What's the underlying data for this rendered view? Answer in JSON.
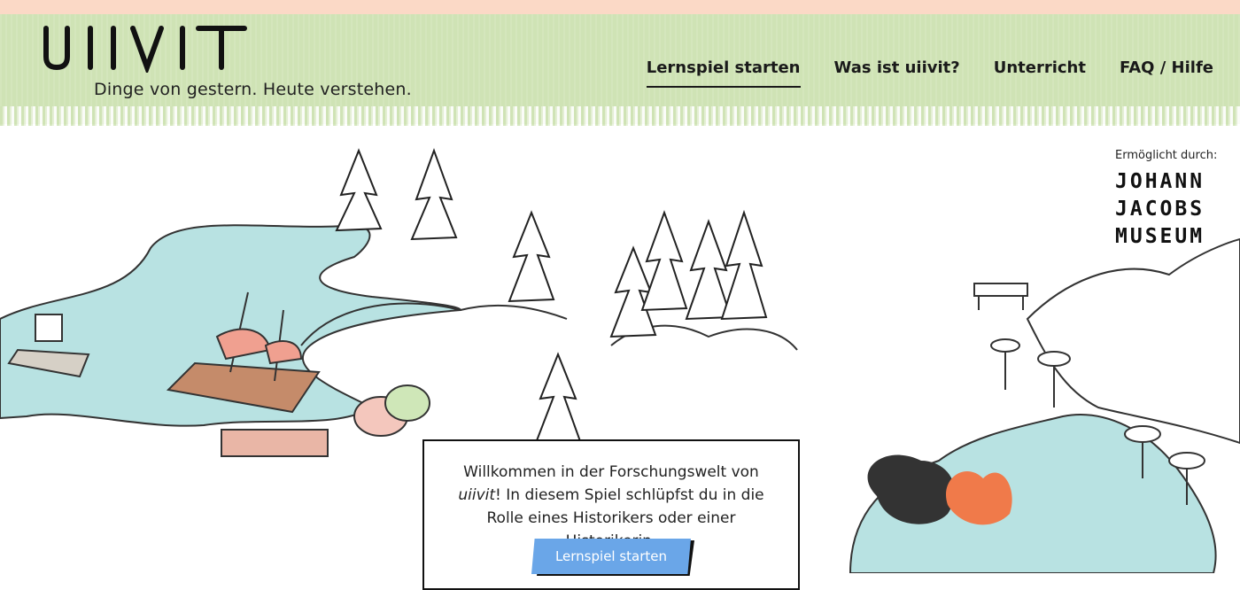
{
  "header": {
    "logo_text": "UIIVIT",
    "tagline": "Dinge von gestern. Heute verstehen.",
    "nav": [
      {
        "label": "Lernspiel starten",
        "active": true
      },
      {
        "label": "Was ist uiivit?"
      },
      {
        "label": "Unterricht"
      },
      {
        "label": "FAQ / Hilfe"
      }
    ]
  },
  "sponsor": {
    "label": "Ermöglicht durch:",
    "lines": [
      "JOHANN",
      "JACOBS",
      "MUSEUM"
    ]
  },
  "welcome": {
    "text_before": "Willkommen in der Forschungswelt von ",
    "brand": "uiivit",
    "text_after": "! In diesem Spiel schlüpfst du in die Rolle eines Historikers oder einer Historikerin.",
    "button_label": "Lernspiel starten"
  },
  "colors": {
    "top_strip": "#fbd9c6",
    "header_bg": "#cfe3b5",
    "water": "#b8e2e2",
    "button": "#6aa6e8"
  }
}
